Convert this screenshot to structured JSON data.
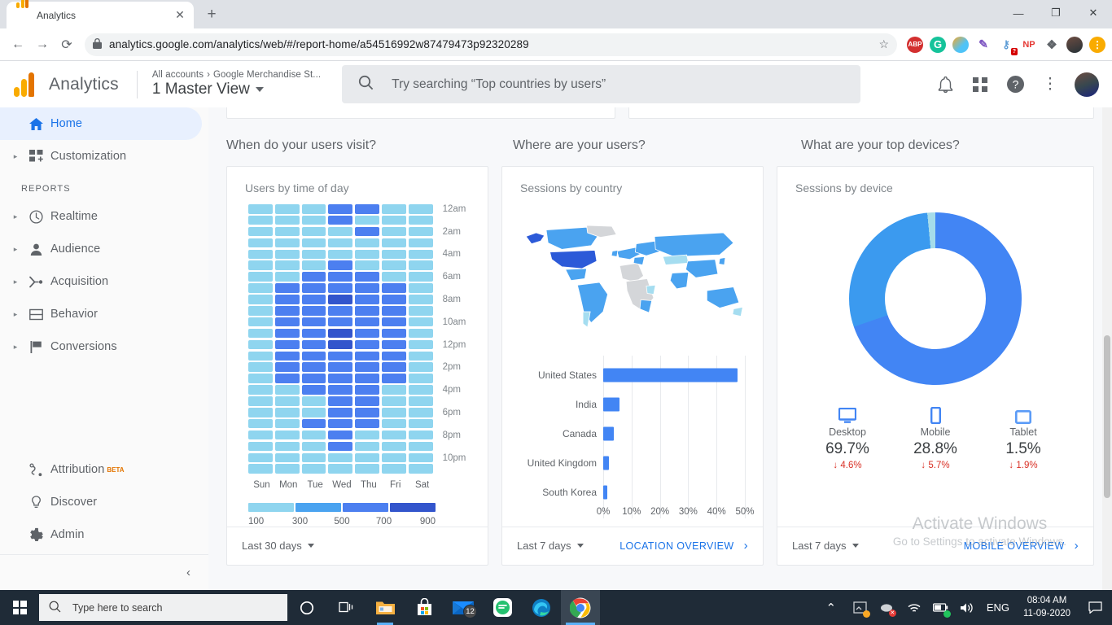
{
  "browser": {
    "tab": {
      "title": "Analytics",
      "favicon": "analytics-icon",
      "close": "✕"
    },
    "newtab_label": "+",
    "window_controls": {
      "minimize": "—",
      "maximize": "❐",
      "close": "✕"
    },
    "back": "←",
    "forward": "→",
    "reload": "⟳",
    "lock_icon": "🔒",
    "url": "analytics.google.com/analytics/web/#/report-home/a54516992w87479473p92320289",
    "star_icon": "☆",
    "extensions": [
      {
        "name": "adblock-plus-extension",
        "label": "ABP"
      },
      {
        "name": "grammarly-extension",
        "label": "G"
      },
      {
        "name": "paint-extension",
        "label": ""
      },
      {
        "name": "colorpick-eyedropper-extension",
        "label": "✎"
      },
      {
        "name": "password-manager-extension",
        "label": "⚷",
        "badge": "?"
      },
      {
        "name": "np-extension",
        "label": "NP"
      },
      {
        "name": "extensions-puzzle-icon",
        "label": "❖"
      },
      {
        "name": "profile-avatar",
        "label": ""
      },
      {
        "name": "chrome-menu-update",
        "label": "⋮"
      }
    ]
  },
  "ga_header": {
    "wordmark": "Analytics",
    "breadcrumb_all": "All accounts",
    "breadcrumb_sep": "›",
    "breadcrumb_property": "Google Merchandise St...",
    "view_name": "1 Master View",
    "search_placeholder": "Try searching “Top countries by users”",
    "icons": {
      "notifications": "🔔",
      "apps": "apps-grid-icon",
      "help": "?",
      "more": "⋮",
      "avatar": "user-avatar"
    }
  },
  "sidebar": {
    "section_label": "REPORTS",
    "items": [
      {
        "label": "Home",
        "icon": "home-icon",
        "active": true,
        "expandable": false
      },
      {
        "label": "Customization",
        "icon": "customization-icon",
        "active": false,
        "expandable": true
      }
    ],
    "reports": [
      {
        "label": "Realtime",
        "icon": "clock-icon"
      },
      {
        "label": "Audience",
        "icon": "person-icon"
      },
      {
        "label": "Acquisition",
        "icon": "acquisition-icon"
      },
      {
        "label": "Behavior",
        "icon": "behavior-icon"
      },
      {
        "label": "Conversions",
        "icon": "flag-icon"
      }
    ],
    "bottom": [
      {
        "label": "Attribution",
        "icon": "attribution-icon",
        "badge": "BETA"
      },
      {
        "label": "Discover",
        "icon": "lightbulb-icon",
        "badge": ""
      },
      {
        "label": "Admin",
        "icon": "gear-icon",
        "badge": ""
      }
    ],
    "collapse_icon": "‹"
  },
  "sections": {
    "when": "When do your users visit?",
    "where": "Where are your users?",
    "devices": "What are your top devices?"
  },
  "cards": {
    "time_of_day": {
      "title": "Users by time of day",
      "range": "Last 30 days",
      "link": "",
      "chevron": ""
    },
    "country": {
      "title": "Sessions by country",
      "range": "Last 7 days",
      "link": "LOCATION OVERVIEW",
      "chevron": "›"
    },
    "device": {
      "title": "Sessions by device",
      "range": "Last 7 days",
      "link": "MOBILE OVERVIEW",
      "chevron": "›"
    }
  },
  "watermark": {
    "line1": "Activate Windows",
    "line2": "Go to Settings to activate Windows."
  },
  "taskbar": {
    "search_placeholder": "Type here to search",
    "search_icon": "🔍",
    "cortana_icon": "○",
    "taskview_icon": "taskview-icon",
    "apps": [
      {
        "name": "file-explorer",
        "icon": "folder-icon"
      },
      {
        "name": "microsoft-store",
        "icon": "store-icon"
      },
      {
        "name": "mail",
        "icon": "mail-icon",
        "badge": "12"
      },
      {
        "name": "messaging-app",
        "icon": "chat-icon"
      },
      {
        "name": "microsoft-edge",
        "icon": "edge-icon"
      },
      {
        "name": "google-chrome",
        "icon": "chrome-icon"
      }
    ],
    "tray": {
      "chevron": "⌃",
      "language": "ENG",
      "time": "08:04 AM",
      "date": "11-09-2020",
      "action_center": "▭"
    }
  },
  "colors": {
    "accent": "#4285f4",
    "heat_1": "#8fd5ef",
    "heat_2": "#4aa3f0",
    "heat_3": "#4c7ff0",
    "heat_4": "#3355cc",
    "map_dark": "#2c5ad8",
    "map_mid": "#4aa3f0",
    "map_light": "#a5ddf0",
    "map_none": "#d4d6d9",
    "donut_desktop": "#4285f4",
    "donut_mobile": "#3b9aef",
    "donut_tablet": "#a5dcea",
    "negative": "#d93025"
  },
  "chart_data": [
    {
      "type": "heatmap",
      "title": "Users by time of day",
      "xlabel": "",
      "ylabel": "",
      "categories": [
        "Sun",
        "Mon",
        "Tue",
        "Wed",
        "Thu",
        "Fri",
        "Sat"
      ],
      "y_ticks": [
        "12am",
        "2am",
        "4am",
        "6am",
        "8am",
        "10am",
        "12pm",
        "2pm",
        "4pm",
        "6pm",
        "8pm",
        "10pm"
      ],
      "rows": 24,
      "legend": {
        "labels": [
          "100",
          "300",
          "500",
          "700",
          "900"
        ],
        "bins": 4
      },
      "levels": [
        [
          1,
          1,
          1,
          3,
          3,
          1,
          1
        ],
        [
          1,
          1,
          1,
          3,
          1,
          1,
          1
        ],
        [
          1,
          1,
          1,
          1,
          3,
          1,
          1
        ],
        [
          1,
          1,
          1,
          1,
          1,
          1,
          1
        ],
        [
          1,
          1,
          1,
          1,
          1,
          1,
          1
        ],
        [
          1,
          1,
          1,
          3,
          1,
          1,
          1
        ],
        [
          1,
          1,
          3,
          3,
          3,
          1,
          1
        ],
        [
          1,
          3,
          3,
          3,
          3,
          3,
          1
        ],
        [
          1,
          3,
          3,
          4,
          3,
          3,
          1
        ],
        [
          1,
          3,
          3,
          3,
          3,
          3,
          1
        ],
        [
          1,
          3,
          3,
          3,
          3,
          3,
          1
        ],
        [
          1,
          3,
          3,
          4,
          3,
          3,
          1
        ],
        [
          1,
          3,
          3,
          4,
          3,
          3,
          1
        ],
        [
          1,
          3,
          3,
          3,
          3,
          3,
          1
        ],
        [
          1,
          3,
          3,
          3,
          3,
          3,
          1
        ],
        [
          1,
          3,
          3,
          3,
          3,
          3,
          1
        ],
        [
          1,
          1,
          3,
          3,
          3,
          1,
          1
        ],
        [
          1,
          1,
          1,
          3,
          3,
          1,
          1
        ],
        [
          1,
          1,
          1,
          3,
          3,
          1,
          1
        ],
        [
          1,
          1,
          3,
          3,
          3,
          1,
          1
        ],
        [
          1,
          1,
          1,
          3,
          1,
          1,
          1
        ],
        [
          1,
          1,
          1,
          3,
          1,
          1,
          1
        ],
        [
          1,
          1,
          1,
          1,
          1,
          1,
          1
        ],
        [
          1,
          1,
          1,
          1,
          1,
          1,
          1
        ]
      ]
    },
    {
      "type": "bar",
      "orientation": "horizontal",
      "title": "Sessions by country",
      "xlabel": "",
      "ylabel": "",
      "categories": [
        "United States",
        "India",
        "Canada",
        "United Kingdom",
        "South Korea"
      ],
      "values": [
        47.5,
        5.8,
        3.6,
        2.0,
        1.3
      ],
      "unit": "%",
      "x_ticks": [
        "0%",
        "10%",
        "20%",
        "30%",
        "40%",
        "50%"
      ],
      "xlim": [
        0,
        50
      ],
      "grid": true
    },
    {
      "type": "pie",
      "variant": "donut",
      "title": "Sessions by device",
      "labels": [
        "Desktop",
        "Mobile",
        "Tablet"
      ],
      "values": [
        69.7,
        28.8,
        1.5
      ],
      "unit": "%",
      "deltas": [
        "4.6%",
        "5.7%",
        "1.9%"
      ],
      "delta_direction": [
        "down",
        "down",
        "down"
      ],
      "delta_arrow": "↓",
      "icons": [
        "desktop-icon",
        "mobile-icon",
        "tablet-icon"
      ]
    },
    {
      "type": "choropleth",
      "title": "Sessions by country map",
      "legend": "world map shaded by session volume",
      "highlighted": [
        "United States"
      ]
    }
  ]
}
